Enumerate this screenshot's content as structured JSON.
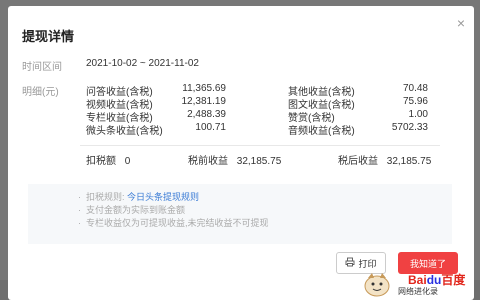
{
  "modal": {
    "title": "提现详情",
    "close_glyph": "×"
  },
  "period": {
    "label": "时间区间",
    "value": "2021-10-02 ~ 2021-11-02"
  },
  "details": {
    "label": "明细(元)",
    "left": [
      {
        "name": "问答收益(含税)",
        "value": "11,365.69"
      },
      {
        "name": "视频收益(含税)",
        "value": "12,381.19"
      },
      {
        "name": "专栏收益(含税)",
        "value": "2,488.39"
      },
      {
        "name": "微头条收益(含税)",
        "value": "100.71"
      }
    ],
    "right": [
      {
        "name": "其他收益(含税)",
        "value": "70.48"
      },
      {
        "name": "图文收益(含税)",
        "value": "75.96"
      },
      {
        "name": "赞赏(含税)",
        "value": "1.00"
      },
      {
        "name": "音频收益(含税)",
        "value": "5702.33"
      }
    ]
  },
  "summary": {
    "tax_label": "扣税额",
    "tax_value": "0",
    "pretax_label": "税前收益",
    "pretax_value": "32,185.75",
    "aftertax_label": "税后收益",
    "aftertax_value": "32,185.75"
  },
  "notes": {
    "rule_prefix": "扣税规则:",
    "rule_link": "今日头条提现规则",
    "note2": "支付金额为实际到账金额",
    "note3": "专栏收益仅为可提现收益,未完结收益不可提现"
  },
  "buttons": {
    "print": "打印",
    "ok": "我知道了"
  },
  "watermark": {
    "logo_a": "Bai",
    "logo_b": "du",
    "logo_c": "百度",
    "sub": "网络进化录"
  }
}
